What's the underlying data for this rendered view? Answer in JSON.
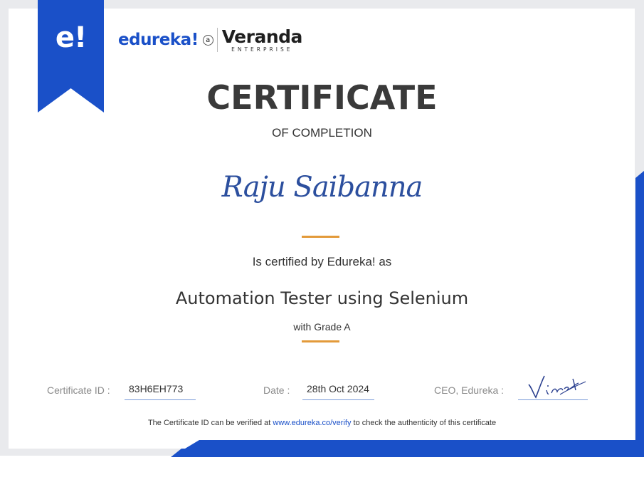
{
  "colors": {
    "brand_blue": "#1a50c8",
    "accent_orange": "#e39a3a",
    "recipient_blue": "#2c4f9e",
    "text_dark": "#333333",
    "label_grey": "#8a8a8a"
  },
  "ribbon": {
    "logo": "e!"
  },
  "brand": {
    "edureka": "edureka!",
    "a_mark": "a",
    "veranda_name": "Veranda",
    "veranda_sub": "ENTERPRISE"
  },
  "certificate": {
    "title": "CERTIFICATE",
    "subtitle": "OF COMPLETION",
    "recipient": "Raju Saibanna",
    "certified_by": "Is certified by Edureka! as",
    "course": "Automation Tester using Selenium",
    "grade": "with Grade A"
  },
  "fields": {
    "certificate_id_label": "Certificate ID :",
    "certificate_id_value": "83H6EH773",
    "date_label": "Date :",
    "date_value": "28th Oct 2024",
    "ceo_label": "CEO, Edureka :"
  },
  "signature": {
    "text": "Vineet",
    "icon": "handwritten-signature"
  },
  "verify": {
    "prefix": "The Certificate ID can be verified at ",
    "link": "www.edureka.co/verify",
    "suffix": " to check the authenticity of this certificate"
  }
}
